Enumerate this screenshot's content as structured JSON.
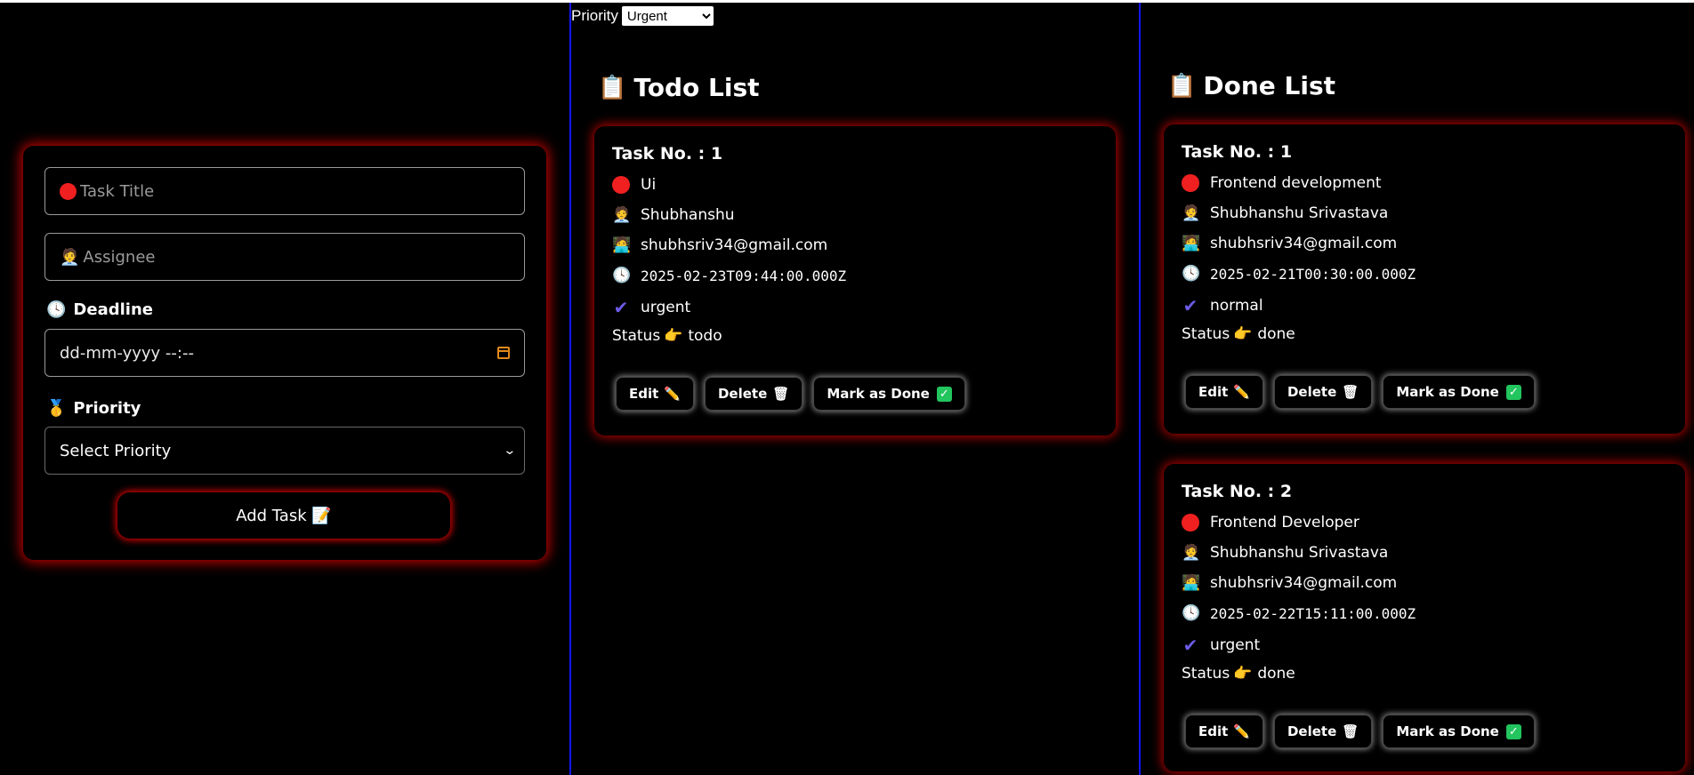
{
  "filter": {
    "label": "Priority",
    "selected": "Urgent"
  },
  "form": {
    "title_placeholder": "Task Title",
    "assignee_placeholder": "Assignee",
    "deadline_label": "Deadline",
    "deadline_placeholder": "dd-mm-yyyy --:--",
    "priority_label": "Priority",
    "priority_selected": "Select Priority",
    "add_button": "Add Task 📝",
    "icons": {
      "title": "red-circle-icon",
      "assignee": "office-worker-icon",
      "deadline": "clock-icon",
      "priority": "medal-icon",
      "calendar": "calendar-icon"
    }
  },
  "todo": {
    "heading": "Todo List",
    "heading_icon": "clipboard-icon",
    "tasks": [
      {
        "number": "Task No. : 1",
        "title": "Ui",
        "assignee": "Shubhanshu",
        "email": "shubhsriv34@gmail.com",
        "deadline": "2025-02-23T09:44:00.000Z",
        "priority": "urgent",
        "status_label": "Status",
        "status": "todo",
        "buttons": {
          "edit": "Edit",
          "delete": "Delete",
          "done": "Mark as Done"
        }
      }
    ]
  },
  "done": {
    "heading": "Done List",
    "heading_icon": "clipboard-icon",
    "tasks": [
      {
        "number": "Task No. : 1",
        "title": "Frontend development",
        "assignee": "Shubhanshu Srivastava",
        "email": "shubhsriv34@gmail.com",
        "deadline": "2025-02-21T00:30:00.000Z",
        "priority": "normal",
        "status_label": "Status",
        "status": "done",
        "buttons": {
          "edit": "Edit",
          "delete": "Delete",
          "done": "Mark as Done"
        }
      },
      {
        "number": "Task No. : 2",
        "title": "Frontend Developer",
        "assignee": "Shubhanshu Srivastava",
        "email": "shubhsriv34@gmail.com",
        "deadline": "2025-02-22T15:11:00.000Z",
        "priority": "urgent",
        "status_label": "Status",
        "status": "done",
        "buttons": {
          "edit": "Edit",
          "delete": "Delete",
          "done": "Mark as Done"
        }
      }
    ]
  },
  "colors": {
    "background": "#000000",
    "glow": "#ff0000",
    "divider": "#1515ff",
    "check": "#6c5ce7",
    "done_check": "#22c55e",
    "calendar": "#e08a1a"
  }
}
